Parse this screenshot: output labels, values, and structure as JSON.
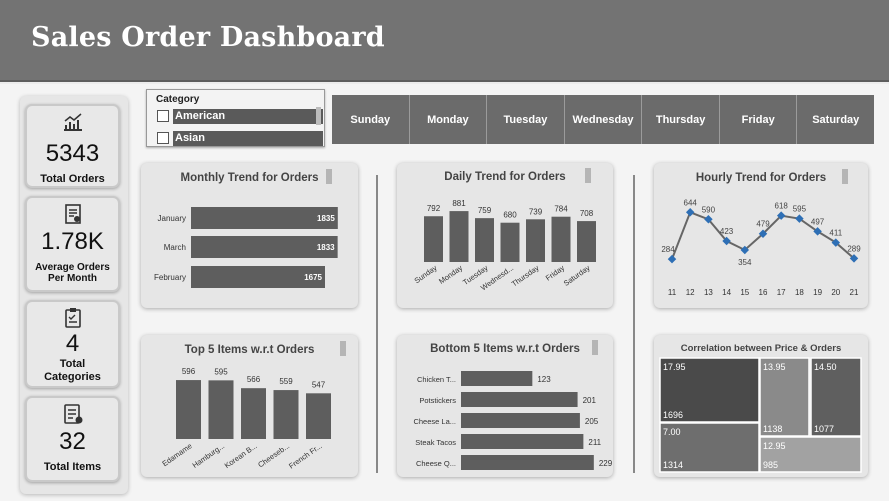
{
  "header": {
    "title": "Sales Order Dashboard"
  },
  "kpis": [
    {
      "icon": "growth-chart-icon",
      "value": "5343",
      "label": "Total Orders"
    },
    {
      "icon": "report-icon",
      "value": "1.78K",
      "label": "Average Orders Per Month"
    },
    {
      "icon": "clipboard-icon",
      "value": "4",
      "label": "Total Categories"
    },
    {
      "icon": "checklist-icon",
      "value": "32",
      "label": "Total Items"
    }
  ],
  "slicer": {
    "title": "Category",
    "options": [
      {
        "label": "American",
        "selected": true
      },
      {
        "label": "Asian",
        "selected": true
      }
    ]
  },
  "days": [
    "Sunday",
    "Monday",
    "Tuesday",
    "Wednesday",
    "Thursday",
    "Friday",
    "Saturday"
  ],
  "colors": {
    "header": "#737373",
    "bar": "#5e5e5e",
    "line": "#666666",
    "point": "#2e6fb5"
  },
  "cards": {
    "monthly": "Monthly Trend for Orders",
    "daily": "Daily Trend for Orders",
    "hourly": "Hourly Trend for Orders",
    "top5": "Top 5 Items w.r.t Orders",
    "bottom5": "Bottom 5 Items w.r.t Orders",
    "corr": "Correlation between Price & Orders"
  },
  "chart_data": [
    {
      "id": "monthly",
      "type": "bar",
      "orientation": "horizontal",
      "title": "Monthly Trend for Orders",
      "categories": [
        "January",
        "March",
        "February"
      ],
      "values": [
        1835,
        1833,
        1675
      ],
      "labels": [
        "1835",
        "1833",
        "1675"
      ],
      "xlim": [
        0,
        2000
      ]
    },
    {
      "id": "daily",
      "type": "bar",
      "title": "Daily Trend for Orders",
      "categories": [
        "Sunday",
        "Monday",
        "Tuesday",
        "Wednesd...",
        "Thursday",
        "Friday",
        "Saturday"
      ],
      "values": [
        792,
        881,
        759,
        680,
        739,
        784,
        708
      ],
      "ylim": [
        0,
        900
      ]
    },
    {
      "id": "hourly",
      "type": "line",
      "title": "Hourly Trend for Orders",
      "x": [
        11,
        12,
        13,
        14,
        15,
        16,
        17,
        18,
        19,
        20,
        21
      ],
      "values": [
        284,
        644,
        590,
        423,
        354,
        479,
        618,
        595,
        497,
        411,
        289
      ],
      "labels": {
        "11": "284",
        "12": "644",
        "13": "590",
        "14": "423",
        "15": "354",
        "16": "479",
        "17": "618",
        "18": "595",
        "19": "497",
        "20": "411",
        "21": "289"
      },
      "ylim": [
        0,
        700
      ]
    },
    {
      "id": "top5",
      "type": "bar",
      "title": "Top 5 Items w.r.t Orders",
      "categories": [
        "Edamame",
        "Hamburg...",
        "Korean B...",
        "Cheeseb...",
        "French Fr..."
      ],
      "values": [
        596,
        595,
        566,
        559,
        547
      ],
      "ylim": [
        0,
        600
      ]
    },
    {
      "id": "bottom5",
      "type": "bar",
      "orientation": "horizontal",
      "title": "Bottom 5 Items w.r.t Orders",
      "categories": [
        "Chicken T...",
        "Potstickers",
        "Cheese La...",
        "Steak Tacos",
        "Cheese Q..."
      ],
      "values": [
        123,
        201,
        205,
        211,
        229
      ],
      "xlim": [
        0,
        250
      ]
    },
    {
      "id": "corr",
      "type": "heatmap",
      "title": "Correlation between Price & Orders",
      "cells": [
        {
          "price": "17.95",
          "orders": "1696",
          "fill": "#4a4a4a"
        },
        {
          "price": "13.95",
          "orders": "1138",
          "fill": "#8a8a8a"
        },
        {
          "price": "14.50",
          "orders": "1077",
          "fill": "#5f5f5f"
        },
        {
          "price": "7.00",
          "orders": "1314",
          "fill": "#6e6e6e"
        },
        {
          "price": "12.95",
          "orders": "985",
          "fill": "#a2a2a2"
        }
      ]
    }
  ]
}
